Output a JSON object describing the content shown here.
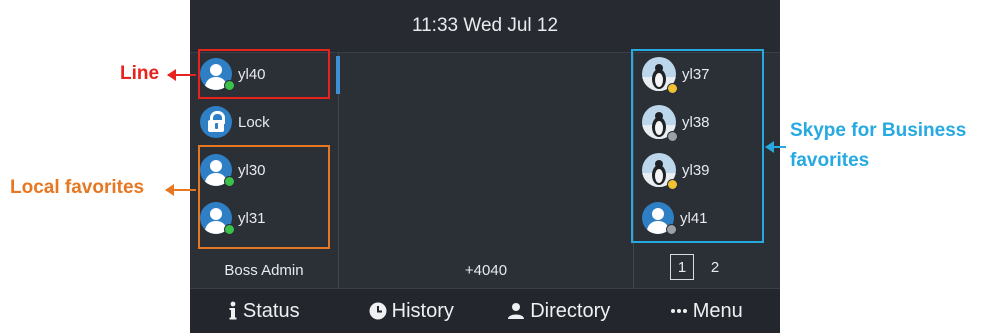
{
  "header": {
    "datetime": "11:33 Wed Jul 12"
  },
  "left_keys": [
    {
      "label": "yl40",
      "type": "contact",
      "status_color": "#3cc24a"
    },
    {
      "label": "Lock",
      "type": "lock"
    },
    {
      "label": "yl30",
      "type": "contact",
      "status_color": "#3cc24a"
    },
    {
      "label": "yl31",
      "type": "contact",
      "status_color": "#3cc24a"
    }
  ],
  "account_name": "Boss Admin",
  "center": {
    "number": "+4040"
  },
  "right_keys": [
    {
      "label": "yl37",
      "type": "photo",
      "status_color": "#f1c232"
    },
    {
      "label": "yl38",
      "type": "photo",
      "status_color": "#9aa0a6"
    },
    {
      "label": "yl39",
      "type": "photo",
      "status_color": "#f1c232"
    },
    {
      "label": "yl41",
      "type": "contact",
      "status_color": "#9aa0a6"
    }
  ],
  "pager": {
    "pages": [
      "1",
      "2"
    ],
    "current": "1"
  },
  "softkeys": [
    {
      "label": "Status",
      "icon": "info-icon"
    },
    {
      "label": "History",
      "icon": "clock-icon"
    },
    {
      "label": "Directory",
      "icon": "person-icon"
    },
    {
      "label": "Menu",
      "icon": "more-dots-icon"
    }
  ],
  "annotations": {
    "line": {
      "text": "Line",
      "color": "#e8231f"
    },
    "local": {
      "text": "Local favorites",
      "color": "#e87722"
    },
    "skype": {
      "text_line1": "Skype for Business",
      "text_line2": "favorites",
      "color": "#27a9e1"
    }
  }
}
